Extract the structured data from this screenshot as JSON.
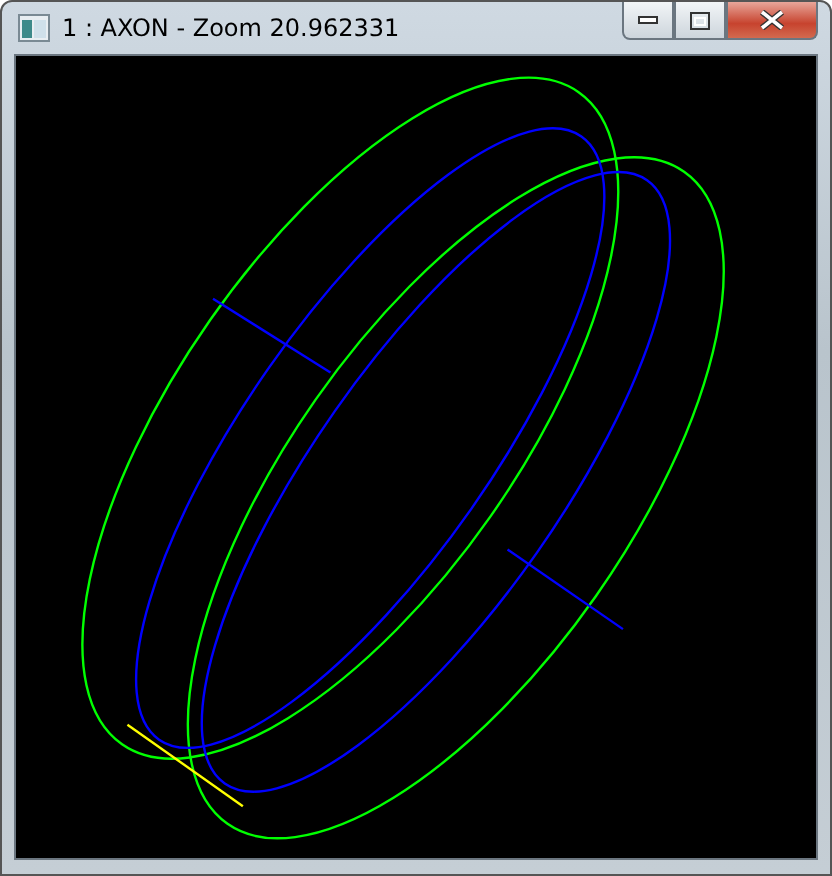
{
  "window": {
    "title": "1 : AXON - Zoom 20.962331"
  }
}
